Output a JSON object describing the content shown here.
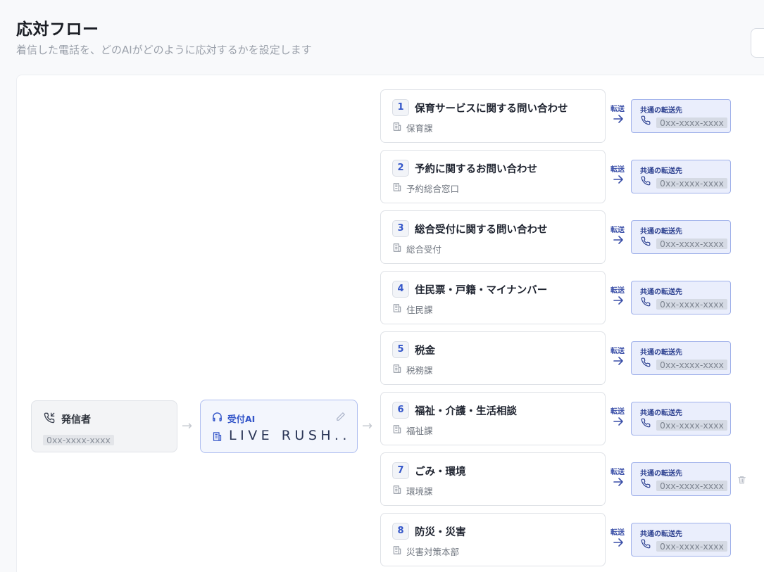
{
  "page": {
    "title": "応対フロー",
    "subtitle": "着信した電話を、どのAIがどのように応対するかを設定します"
  },
  "caller": {
    "label": "発信者",
    "number": "0xx-xxxx-xxxx",
    "icon": "phone-incoming-icon"
  },
  "ai": {
    "label": "受付AI",
    "name": "LIVE RUSH...",
    "icons": [
      "headset-icon",
      "pencil-icon",
      "building-icon"
    ]
  },
  "transfer": {
    "label": "転送",
    "dest_label": "共通の転送先",
    "dest_number": "0xx-xxxx-xxxx"
  },
  "routes": [
    {
      "index": "1",
      "title": "保育サービスに関する問い合わせ",
      "dept": "保育課"
    },
    {
      "index": "2",
      "title": "予約に関するお問い合わせ",
      "dept": "予約総合窓口"
    },
    {
      "index": "3",
      "title": "総合受付に関する問い合わせ",
      "dept": "総合受付"
    },
    {
      "index": "4",
      "title": "住民票・戸籍・マイナンバー",
      "dept": "住民課"
    },
    {
      "index": "5",
      "title": "税金",
      "dept": "税務課"
    },
    {
      "index": "6",
      "title": "福祉・介護・生活相談",
      "dept": "福祉課"
    },
    {
      "index": "7",
      "title": "ごみ・環境",
      "dept": "環境課"
    },
    {
      "index": "8",
      "title": "防災・災害",
      "dept": "災害対策本部"
    }
  ],
  "colors": {
    "accent": "#3456c9",
    "dest_bg": "#eaeefc",
    "dest_border": "#9fb0ea",
    "ai_border": "#aebdf0"
  }
}
